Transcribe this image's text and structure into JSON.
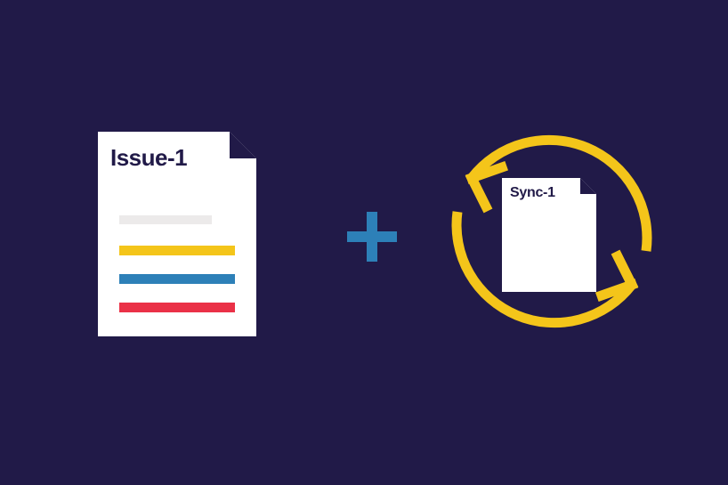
{
  "issue_doc": {
    "title": "Issue-1",
    "lines": [
      {
        "name": "gray",
        "color": "#eceaea"
      },
      {
        "name": "yellow",
        "color": "#f4c51a"
      },
      {
        "name": "blue",
        "color": "#2d80b8"
      },
      {
        "name": "red",
        "color": "#ea3147"
      }
    ]
  },
  "plus": {
    "color": "#2d80b8"
  },
  "sync_doc": {
    "title": "Sync-1"
  },
  "sync_arrows": {
    "color": "#f4c51a"
  },
  "background": "#211a48"
}
